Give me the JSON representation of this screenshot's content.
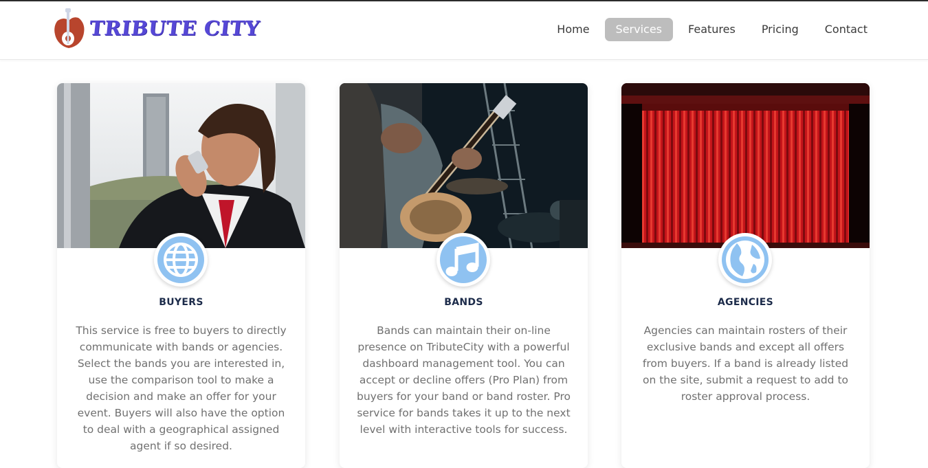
{
  "brand": {
    "name": "TRIBUTE CITY"
  },
  "nav": {
    "items": [
      {
        "label": "Home",
        "active": false
      },
      {
        "label": "Services",
        "active": true
      },
      {
        "label": "Features",
        "active": false
      },
      {
        "label": "Pricing",
        "active": false
      },
      {
        "label": "Contact",
        "active": false
      }
    ]
  },
  "colors": {
    "brand": "#5648d6",
    "icon_bg": "#8fc2f1",
    "title": "#1c2b4a",
    "body_text": "#707070"
  },
  "cards": [
    {
      "title": "BUYERS",
      "icon": "globe-icon",
      "image": "businessman-on-phone",
      "text": "This service is free to buyers to directly communicate with bands or agencies. Select the bands you are interested in, use the comparison tool to make a decision and make an offer for your event. Buyers will also have the option to deal with a geographical assigned agent if so desired."
    },
    {
      "title": "BANDS",
      "icon": "music-note-icon",
      "image": "band-playing-guitar",
      "text": "Bands can maintain their on-line presence on TributeCity with a powerful dashboard management tool. You can accept or decline offers (Pro Plan) from buyers for your band or band roster. Pro service for bands takes it up to the next level with interactive tools for success."
    },
    {
      "title": "AGENCIES",
      "icon": "world-map-icon",
      "image": "red-stage-curtain",
      "text": "Agencies can maintain rosters of their exclusive bands and except all offers from buyers. If a band is already listed on the site, submit a request to add to roster approval process."
    }
  ]
}
